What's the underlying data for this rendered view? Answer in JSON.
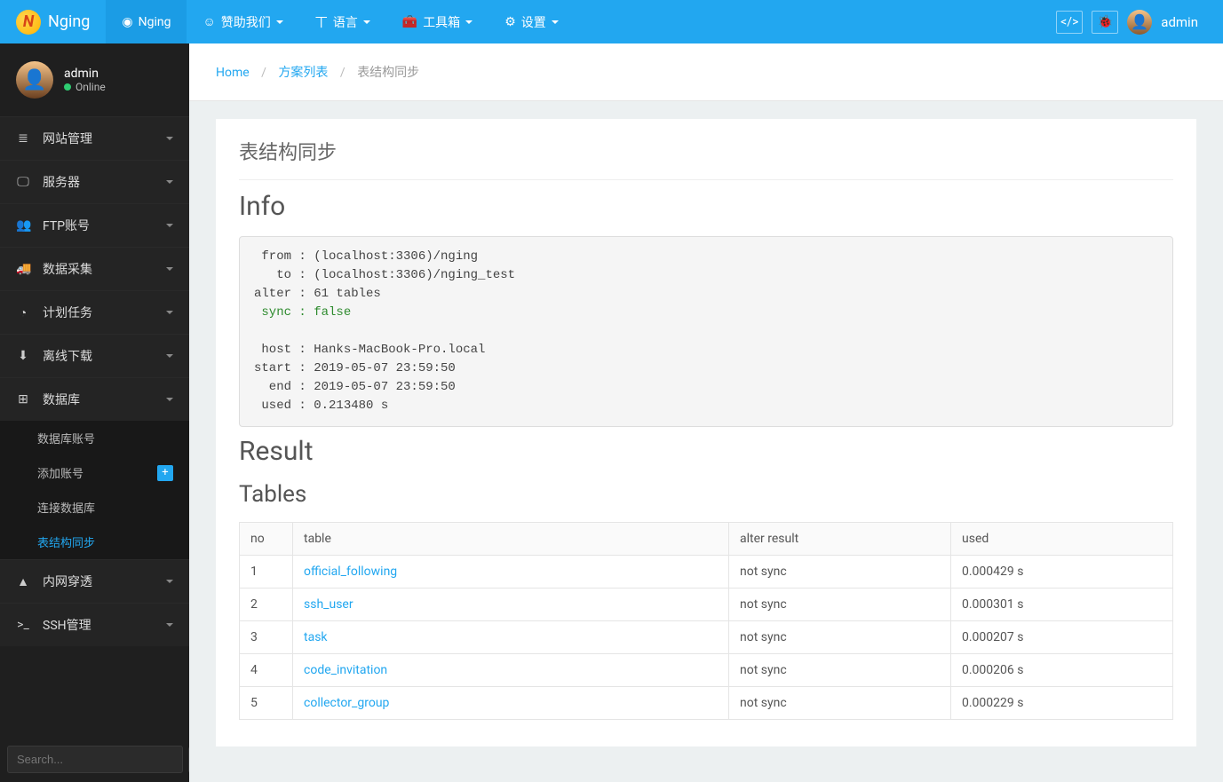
{
  "brand": "Nging",
  "topnav": [
    {
      "icon": "◉",
      "label": "Nging",
      "active": true,
      "dropdown": false
    },
    {
      "icon": "☺",
      "label": "赞助我们",
      "dropdown": true
    },
    {
      "icon": "丅",
      "label": "语言",
      "dropdown": true
    },
    {
      "icon": "🧰",
      "label": "工具箱",
      "dropdown": true
    },
    {
      "icon": "⚙",
      "label": "设置",
      "dropdown": true
    }
  ],
  "topuser": "admin",
  "side_user": {
    "name": "admin",
    "status": "Online"
  },
  "sidebar": [
    {
      "icon": "≣",
      "label": "网站管理"
    },
    {
      "icon": "🖵",
      "label": "服务器"
    },
    {
      "icon": "👥",
      "label": "FTP账号"
    },
    {
      "icon": "🚚",
      "label": "数据采集"
    },
    {
      "icon": "◔",
      "label": "计划任务"
    },
    {
      "icon": "⬇",
      "label": "离线下载"
    },
    {
      "icon": "⊞",
      "label": "数据库",
      "open": true,
      "subs": [
        {
          "label": "数据库账号"
        },
        {
          "label": "添加账号",
          "plus": true
        },
        {
          "label": "连接数据库"
        },
        {
          "label": "表结构同步",
          "active": true
        }
      ]
    },
    {
      "icon": "▲",
      "label": "内网穿透"
    },
    {
      "icon": ">_",
      "label": "SSH管理"
    }
  ],
  "search_placeholder": "Search...",
  "breadcrumb": {
    "home": "Home",
    "list": "方案列表",
    "current": "表结构同步"
  },
  "page_title": "表结构同步",
  "info_heading": "Info",
  "info_lines": {
    "from": " from : (localhost:3306)/nging",
    "to": "   to : (localhost:3306)/nging_test",
    "alter": "alter : 61 tables",
    "sync": " sync : false",
    "blank": "",
    "host": " host : Hanks-MacBook-Pro.local",
    "start": "start : 2019-05-07 23:59:50",
    "end": "  end : 2019-05-07 23:59:50",
    "used": " used : 0.213480 s"
  },
  "result_heading": "Result",
  "tables_heading": "Tables",
  "thead": {
    "no": "no",
    "table": "table",
    "alter": "alter result",
    "used": "used"
  },
  "rows": [
    {
      "no": "1",
      "table": "official_following",
      "alter": "not sync",
      "used": "0.000429 s"
    },
    {
      "no": "2",
      "table": "ssh_user",
      "alter": "not sync",
      "used": "0.000301 s"
    },
    {
      "no": "3",
      "table": "task",
      "alter": "not sync",
      "used": "0.000207 s"
    },
    {
      "no": "4",
      "table": "code_invitation",
      "alter": "not sync",
      "used": "0.000206 s"
    },
    {
      "no": "5",
      "table": "collector_group",
      "alter": "not sync",
      "used": "0.000229 s"
    }
  ]
}
